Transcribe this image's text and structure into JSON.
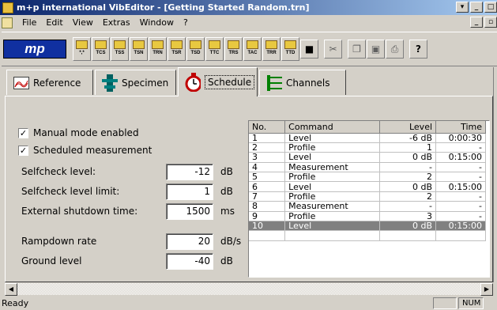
{
  "window": {
    "title": "m+p international VibEditor - [Getting Started Random.trn]"
  },
  "menu": [
    "File",
    "Edit",
    "View",
    "Extras",
    "Window",
    "?"
  ],
  "toolbar": {
    "logo": "mp",
    "buttons": [
      "*,*",
      "TCS",
      "TSS",
      "TSN",
      "TRN",
      "TSR",
      "TSD",
      "TTC",
      "TRS",
      "TAC",
      "TRR",
      "TTD"
    ]
  },
  "tabs": [
    {
      "label": "Reference",
      "icon": "reference-chart-icon"
    },
    {
      "label": "Specimen",
      "icon": "specimen-icon"
    },
    {
      "label": "Schedule",
      "icon": "stopwatch-icon",
      "active": true
    },
    {
      "label": "Channels",
      "icon": "channels-icon"
    }
  ],
  "schedule": {
    "manual_mode": {
      "label": "Manual mode enabled",
      "checked": true
    },
    "scheduled_measurement": {
      "label": "Scheduled measurement",
      "checked": true
    },
    "fields": [
      {
        "label": "Selfcheck level:",
        "value": "-12",
        "unit": "dB"
      },
      {
        "label": "Selfcheck level limit:",
        "value": "1",
        "unit": "dB"
      },
      {
        "label": "External shutdown time:",
        "value": "1500",
        "unit": "ms"
      },
      {
        "label": "Rampdown rate",
        "value": "20",
        "unit": "dB/s"
      },
      {
        "label": "Ground level",
        "value": "-40",
        "unit": "dB"
      }
    ],
    "table": {
      "headers": [
        "No.",
        "Command",
        "Level",
        "Time"
      ],
      "rows": [
        [
          "1",
          "Level",
          "-6 dB",
          "0:00:30"
        ],
        [
          "2",
          "Profile",
          "1",
          "-"
        ],
        [
          "3",
          "Level",
          "0 dB",
          "0:15:00"
        ],
        [
          "4",
          "Measurement",
          "-",
          "-"
        ],
        [
          "5",
          "Profile",
          "2",
          "-"
        ],
        [
          "6",
          "Level",
          "0 dB",
          "0:15:00"
        ],
        [
          "7",
          "Profile",
          "2",
          "-"
        ],
        [
          "8",
          "Measurement",
          "-",
          "-"
        ],
        [
          "9",
          "Profile",
          "3",
          "-"
        ],
        [
          "10",
          "Level",
          "0 dB",
          "0:15:00"
        ]
      ],
      "selected_row": 9
    }
  },
  "status": {
    "text": "Ready",
    "num": "NUM"
  }
}
